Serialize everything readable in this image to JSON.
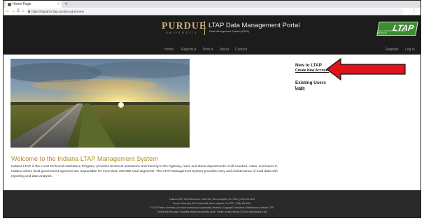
{
  "browser": {
    "tab_title": "Home Page",
    "tab_close": "×",
    "new_tab": "+",
    "back": "←",
    "forward": "→",
    "reload": "C",
    "home": "⌂",
    "url": "https://ltapdms.ltap.purdue.edu/Home",
    "menu": "⋮"
  },
  "header": {
    "brand": "PURDUE",
    "brand_sub": "UNIVERSITY",
    "portal_title": "LTAP Data Management Portal",
    "portal_sub": "Data Management System (DMS)",
    "logo_text": "LTAP",
    "logo_sub": "LOCAL TECHNICAL ASSISTANCE PROGRAM",
    "nav": {
      "home": "Home",
      "reports": "Reports ▾",
      "tools": "Tools ▾",
      "about": "About",
      "contact": "Contact",
      "register": "Register",
      "login": "Log in"
    }
  },
  "main": {
    "welcome_title": "Welcome to the Indiana LTAP Management System",
    "intro": "Indiana LTAP is the Local Technical Assistance Program, provides technical assistance and training to the highway, road, and street departments of all counties, cities, and towns in Indiana where local government agencies are responsible for more than 400,000 road segments. The LTAP Management System provides entry and maintenance of road data with reporting and data analysis."
  },
  "side": {
    "new_heading": "New to LTAP",
    "create_link": "Create New Account",
    "existing_heading": "Existing Users",
    "login_link": "Login"
  },
  "footer": {
    "line1": "Indiana LTAP, 1205 Mann Drive, Suite 200, West Lafayette, IN 47906 | (765) 494-2164",
    "line2": "Purdue University, 610 Purdue Mall, West Lafayette, IN 47907, (765) 494-4600",
    "line3": "© 2019 Purdue University | An equal access/equal opportunity university | Copyright Complaints | Maintained by Indiana LTAP",
    "line4": "Trouble with this page? Disability-related accessibility issue? Please contact Indiana LTAP at inltap@purdue.edu"
  },
  "colors": {
    "header_bg": "#1c1c1c",
    "purdue_gold": "#c8b277",
    "welcome_gold": "#b38b22",
    "ltap_green": "#3f8a34",
    "arrow_red": "#e0141b",
    "footer_bg": "#2a2a2a"
  }
}
